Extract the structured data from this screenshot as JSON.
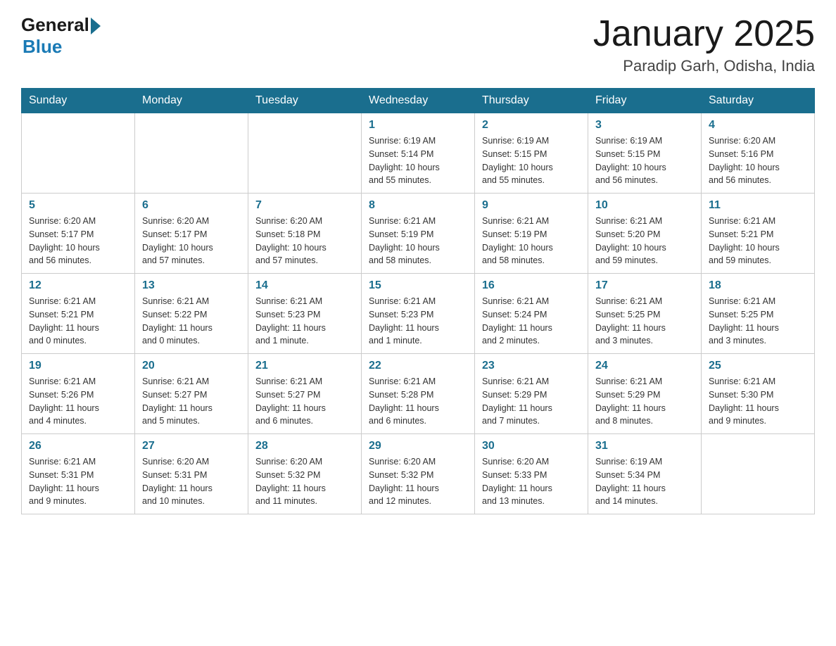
{
  "header": {
    "logo_general": "General",
    "logo_blue": "Blue",
    "month_title": "January 2025",
    "location": "Paradip Garh, Odisha, India"
  },
  "days_of_week": [
    "Sunday",
    "Monday",
    "Tuesday",
    "Wednesday",
    "Thursday",
    "Friday",
    "Saturday"
  ],
  "weeks": [
    [
      {
        "day": "",
        "info": ""
      },
      {
        "day": "",
        "info": ""
      },
      {
        "day": "",
        "info": ""
      },
      {
        "day": "1",
        "info": "Sunrise: 6:19 AM\nSunset: 5:14 PM\nDaylight: 10 hours\nand 55 minutes."
      },
      {
        "day": "2",
        "info": "Sunrise: 6:19 AM\nSunset: 5:15 PM\nDaylight: 10 hours\nand 55 minutes."
      },
      {
        "day": "3",
        "info": "Sunrise: 6:19 AM\nSunset: 5:15 PM\nDaylight: 10 hours\nand 56 minutes."
      },
      {
        "day": "4",
        "info": "Sunrise: 6:20 AM\nSunset: 5:16 PM\nDaylight: 10 hours\nand 56 minutes."
      }
    ],
    [
      {
        "day": "5",
        "info": "Sunrise: 6:20 AM\nSunset: 5:17 PM\nDaylight: 10 hours\nand 56 minutes."
      },
      {
        "day": "6",
        "info": "Sunrise: 6:20 AM\nSunset: 5:17 PM\nDaylight: 10 hours\nand 57 minutes."
      },
      {
        "day": "7",
        "info": "Sunrise: 6:20 AM\nSunset: 5:18 PM\nDaylight: 10 hours\nand 57 minutes."
      },
      {
        "day": "8",
        "info": "Sunrise: 6:21 AM\nSunset: 5:19 PM\nDaylight: 10 hours\nand 58 minutes."
      },
      {
        "day": "9",
        "info": "Sunrise: 6:21 AM\nSunset: 5:19 PM\nDaylight: 10 hours\nand 58 minutes."
      },
      {
        "day": "10",
        "info": "Sunrise: 6:21 AM\nSunset: 5:20 PM\nDaylight: 10 hours\nand 59 minutes."
      },
      {
        "day": "11",
        "info": "Sunrise: 6:21 AM\nSunset: 5:21 PM\nDaylight: 10 hours\nand 59 minutes."
      }
    ],
    [
      {
        "day": "12",
        "info": "Sunrise: 6:21 AM\nSunset: 5:21 PM\nDaylight: 11 hours\nand 0 minutes."
      },
      {
        "day": "13",
        "info": "Sunrise: 6:21 AM\nSunset: 5:22 PM\nDaylight: 11 hours\nand 0 minutes."
      },
      {
        "day": "14",
        "info": "Sunrise: 6:21 AM\nSunset: 5:23 PM\nDaylight: 11 hours\nand 1 minute."
      },
      {
        "day": "15",
        "info": "Sunrise: 6:21 AM\nSunset: 5:23 PM\nDaylight: 11 hours\nand 1 minute."
      },
      {
        "day": "16",
        "info": "Sunrise: 6:21 AM\nSunset: 5:24 PM\nDaylight: 11 hours\nand 2 minutes."
      },
      {
        "day": "17",
        "info": "Sunrise: 6:21 AM\nSunset: 5:25 PM\nDaylight: 11 hours\nand 3 minutes."
      },
      {
        "day": "18",
        "info": "Sunrise: 6:21 AM\nSunset: 5:25 PM\nDaylight: 11 hours\nand 3 minutes."
      }
    ],
    [
      {
        "day": "19",
        "info": "Sunrise: 6:21 AM\nSunset: 5:26 PM\nDaylight: 11 hours\nand 4 minutes."
      },
      {
        "day": "20",
        "info": "Sunrise: 6:21 AM\nSunset: 5:27 PM\nDaylight: 11 hours\nand 5 minutes."
      },
      {
        "day": "21",
        "info": "Sunrise: 6:21 AM\nSunset: 5:27 PM\nDaylight: 11 hours\nand 6 minutes."
      },
      {
        "day": "22",
        "info": "Sunrise: 6:21 AM\nSunset: 5:28 PM\nDaylight: 11 hours\nand 6 minutes."
      },
      {
        "day": "23",
        "info": "Sunrise: 6:21 AM\nSunset: 5:29 PM\nDaylight: 11 hours\nand 7 minutes."
      },
      {
        "day": "24",
        "info": "Sunrise: 6:21 AM\nSunset: 5:29 PM\nDaylight: 11 hours\nand 8 minutes."
      },
      {
        "day": "25",
        "info": "Sunrise: 6:21 AM\nSunset: 5:30 PM\nDaylight: 11 hours\nand 9 minutes."
      }
    ],
    [
      {
        "day": "26",
        "info": "Sunrise: 6:21 AM\nSunset: 5:31 PM\nDaylight: 11 hours\nand 9 minutes."
      },
      {
        "day": "27",
        "info": "Sunrise: 6:20 AM\nSunset: 5:31 PM\nDaylight: 11 hours\nand 10 minutes."
      },
      {
        "day": "28",
        "info": "Sunrise: 6:20 AM\nSunset: 5:32 PM\nDaylight: 11 hours\nand 11 minutes."
      },
      {
        "day": "29",
        "info": "Sunrise: 6:20 AM\nSunset: 5:32 PM\nDaylight: 11 hours\nand 12 minutes."
      },
      {
        "day": "30",
        "info": "Sunrise: 6:20 AM\nSunset: 5:33 PM\nDaylight: 11 hours\nand 13 minutes."
      },
      {
        "day": "31",
        "info": "Sunrise: 6:19 AM\nSunset: 5:34 PM\nDaylight: 11 hours\nand 14 minutes."
      },
      {
        "day": "",
        "info": ""
      }
    ]
  ]
}
